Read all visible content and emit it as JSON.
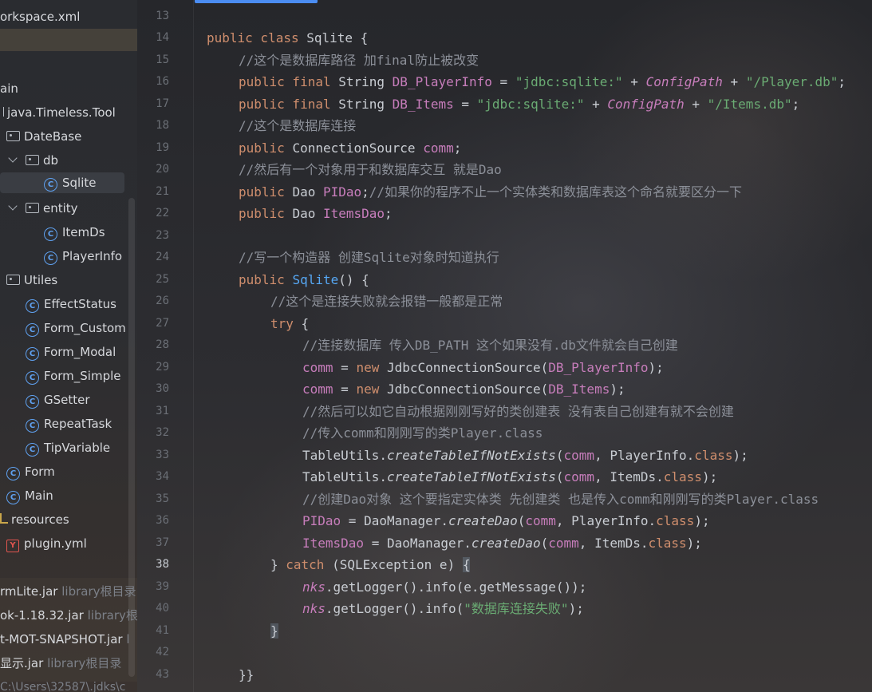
{
  "project_tree": {
    "items": [
      {
        "label": "orkspace.xml",
        "icon": "file-icon",
        "kind": "file"
      },
      {
        "label": "ain",
        "icon": "none",
        "kind": "folder"
      },
      {
        "label": "java.Timeless.Tool",
        "icon": "package-icon",
        "kind": "package"
      },
      {
        "label": "DateBase",
        "icon": "folder-icon",
        "kind": "folder"
      },
      {
        "label": "db",
        "icon": "folder-icon",
        "kind": "folder"
      },
      {
        "label": "Sqlite",
        "icon": "class-icon",
        "kind": "class"
      },
      {
        "label": "entity",
        "icon": "folder-icon",
        "kind": "folder"
      },
      {
        "label": "ItemDs",
        "icon": "class-icon",
        "kind": "class"
      },
      {
        "label": "PlayerInfo",
        "icon": "class-icon",
        "kind": "class"
      },
      {
        "label": "Utiles",
        "icon": "folder-icon",
        "kind": "folder"
      },
      {
        "label": "EffectStatus",
        "icon": "class-icon",
        "kind": "class"
      },
      {
        "label": "Form_Custom",
        "icon": "class-icon",
        "kind": "class"
      },
      {
        "label": "Form_Modal",
        "icon": "class-icon",
        "kind": "class"
      },
      {
        "label": "Form_Simple",
        "icon": "class-icon",
        "kind": "class"
      },
      {
        "label": "GSetter",
        "icon": "class-icon",
        "kind": "class"
      },
      {
        "label": "RepeatTask",
        "icon": "class-icon",
        "kind": "class"
      },
      {
        "label": "TipVariable",
        "icon": "class-icon",
        "kind": "class"
      },
      {
        "label": "Form",
        "icon": "class-icon",
        "kind": "class"
      },
      {
        "label": "Main",
        "icon": "class-icon",
        "kind": "class"
      },
      {
        "label": "resources",
        "icon": "resources-folder-icon",
        "kind": "folder"
      },
      {
        "label": "plugin.yml",
        "icon": "yaml-file-icon",
        "kind": "file"
      }
    ],
    "libraries": [
      {
        "name": "rmLite.jar",
        "note": "library根目录"
      },
      {
        "name": "ok-1.18.32.jar",
        "note": "library根目"
      },
      {
        "name": "t-MOT-SNAPSHOT.jar",
        "note": "l"
      },
      {
        "name": "显示.jar",
        "note": "library根目录"
      }
    ],
    "jdk_path": "C:\\Users\\32587\\.jdks\\c"
  },
  "editor": {
    "current_line": 38,
    "line_numbers": [
      "13",
      "14",
      "15",
      "16",
      "17",
      "18",
      "19",
      "20",
      "21",
      "22",
      "23",
      "24",
      "25",
      "26",
      "27",
      "28",
      "29",
      "30",
      "31",
      "32",
      "33",
      "34",
      "35",
      "36",
      "37",
      "38",
      "39",
      "40",
      "41",
      "42",
      "43"
    ],
    "code": {
      "l14_a": "public class ",
      "l14_b": "Sqlite {",
      "l15": "//这个是数据库路径 加final防止被改变",
      "l16_kw": "public final ",
      "l16_type": "String ",
      "l16_field": "DB_PlayerInfo",
      "l16_eq": " = ",
      "l16_str": "\"jdbc:sqlite:\"",
      "l16_plus": " + ",
      "l16_cfg": "ConfigPath",
      "l16_plus2": " + ",
      "l16_str2": "\"/Player.db\"",
      "l16_end": ";",
      "l17_kw": "public final ",
      "l17_type": "String ",
      "l17_field": "DB_Items",
      "l17_eq": " = ",
      "l17_str": "\"jdbc:sqlite:\"",
      "l17_plus": " + ",
      "l17_cfg": "ConfigPath",
      "l17_plus2": " + ",
      "l17_str2": "\"/Items.db\"",
      "l17_end": ";",
      "l18": "//这个是数据库连接",
      "l19_kw": "public ",
      "l19_type": "ConnectionSource ",
      "l19_field": "comm",
      "l19_end": ";",
      "l20": "//然后有一个对象用于和数据库交互 就是Dao",
      "l21_kw": "public ",
      "l21_type": "Dao ",
      "l21_field": "PIDao",
      "l21_end": ";",
      "l21_cmt": "//如果你的程序不止一个实体类和数据库表这个命名就要区分一下",
      "l22_kw": "public ",
      "l22_type": "Dao ",
      "l22_field": "ItemsDao",
      "l22_end": ";",
      "l24": "//写一个构造器 创建Sqlite对象时知道执行",
      "l25_kw": "public ",
      "l25_name": "Sqlite",
      "l25_end": "() {",
      "l26": "//这个是连接失败就会报错一般都是正常",
      "l27_kw": "try",
      "l27_end": " {",
      "l28": "//连接数据库 传入DB_PATH 这个如果没有.db文件就会自己创建",
      "l29_f": "comm",
      "l29_eq": " = ",
      "l29_new": "new ",
      "l29_cls": "JdbcConnectionSource(",
      "l29_arg": "DB_PlayerInfo",
      "l29_end": ");",
      "l30_f": "comm",
      "l30_eq": " = ",
      "l30_new": "new ",
      "l30_cls": "JdbcConnectionSource(",
      "l30_arg": "DB_Items",
      "l30_end": ");",
      "l31": "//然后可以如它自动根据刚刚写好的类创建表 没有表自己创建有就不会创建",
      "l32": "//传入comm和刚刚写的类Player.class",
      "l33_a": "TableUtils.",
      "l33_m": "createTableIfNotExists",
      "l33_b": "(",
      "l33_f": "comm",
      "l33_c": ", PlayerInfo.",
      "l33_kw": "class",
      "l33_end": ");",
      "l34_a": "TableUtils.",
      "l34_m": "createTableIfNotExists",
      "l34_b": "(",
      "l34_f": "comm",
      "l34_c": ", ItemDs.",
      "l34_kw": "class",
      "l34_end": ");",
      "l35": "//创建Dao对象 这个要指定实体类 先创建类 也是传入comm和刚刚写的类Player.class",
      "l36_f": "PIDao",
      "l36_a": " = DaoManager.",
      "l36_m": "createDao",
      "l36_b": "(",
      "l36_f2": "comm",
      "l36_c": ", PlayerInfo.",
      "l36_kw": "class",
      "l36_end": ");",
      "l37_f": "ItemsDao",
      "l37_a": " = DaoManager.",
      "l37_m": "createDao",
      "l37_b": "(",
      "l37_f2": "comm",
      "l37_c": ", ItemDs.",
      "l37_kw": "class",
      "l37_end": ");",
      "l38_a": "} ",
      "l38_kw": "catch",
      "l38_b": " (SQLException e) ",
      "l38_br": "{",
      "l39_f": "nks",
      "l39_a": ".getLogger().info(e.getMessage());",
      "l40_f": "nks",
      "l40_a": ".getLogger().info(",
      "l40_str": "\"数据库连接失败\"",
      "l40_end": ");",
      "l41_br": "}",
      "l43": "}}"
    }
  },
  "colors": {
    "keyword": "#cf8e6d",
    "field": "#c77dbb",
    "string": "#6aab73",
    "comment": "#8c9099",
    "method": "#56a8f5",
    "accent": "#4b8df2"
  }
}
